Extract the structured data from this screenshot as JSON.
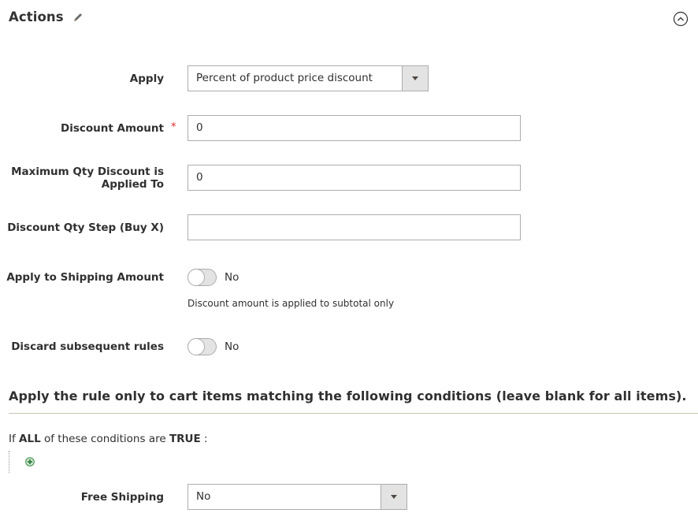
{
  "section": {
    "title": "Actions",
    "edit_icon": "pencil-icon",
    "collapse_icon": "chevron-up-circle-icon"
  },
  "fields": {
    "apply": {
      "label": "Apply",
      "value": "Percent of product price discount"
    },
    "discount_amount": {
      "label": "Discount Amount",
      "required_mark": "*",
      "value": "0"
    },
    "max_qty": {
      "label_line1": "Maximum Qty Discount is",
      "label_line2": "Applied To",
      "value": "0"
    },
    "qty_step": {
      "label": "Discount Qty Step (Buy X)",
      "value": ""
    },
    "apply_shipping": {
      "label": "Apply to Shipping Amount",
      "state": "No",
      "note": "Discount amount is applied to subtotal only"
    },
    "discard_rules": {
      "label": "Discard subsequent rules",
      "state": "No"
    }
  },
  "conditions": {
    "heading": "Apply the rule only to cart items matching the following conditions (leave blank for all items).",
    "prefix": "If",
    "aggregator": "ALL",
    "middle": " of these conditions are",
    "value": "TRUE",
    "suffix": " :",
    "add_icon": "add-condition-icon"
  },
  "free_shipping": {
    "label": "Free Shipping",
    "value": "No"
  }
}
